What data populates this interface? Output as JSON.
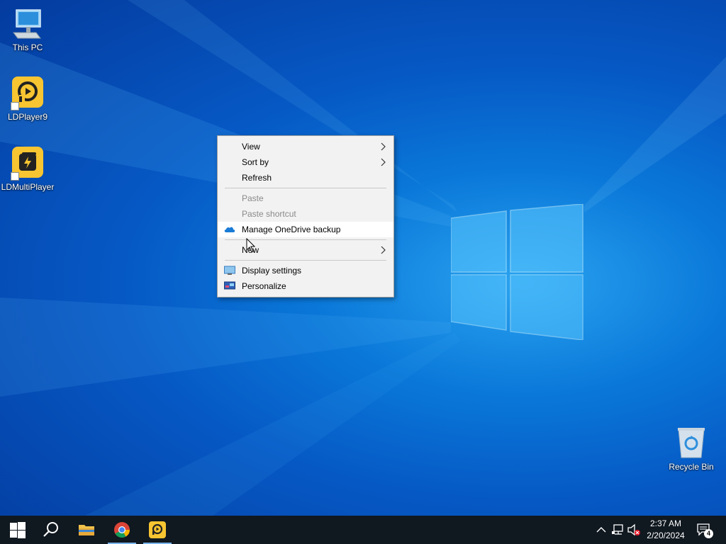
{
  "desktop": {
    "icons": [
      {
        "label": "This PC"
      },
      {
        "label": "LDPlayer9"
      },
      {
        "label": "LDMultiPlayer"
      },
      {
        "label": "Recycle Bin"
      }
    ]
  },
  "context_menu": {
    "items": [
      {
        "label": "View",
        "submenu": true
      },
      {
        "label": "Sort by",
        "submenu": true
      },
      {
        "label": "Refresh"
      },
      {
        "label": "Paste",
        "disabled": true
      },
      {
        "label": "Paste shortcut",
        "disabled": true
      },
      {
        "label": "Manage OneDrive backup",
        "icon": "onedrive-icon"
      },
      {
        "label": "New",
        "submenu": true
      },
      {
        "label": "Display settings",
        "icon": "display-icon"
      },
      {
        "label": "Personalize",
        "icon": "personalize-icon"
      }
    ]
  },
  "taskbar": {
    "time": "2:37 AM",
    "date": "2/20/2024",
    "notification_count": "4"
  }
}
